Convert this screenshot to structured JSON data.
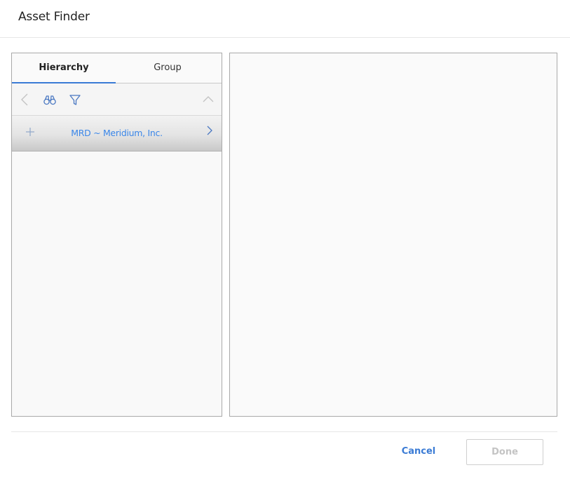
{
  "dialog": {
    "title": "Asset Finder"
  },
  "tabs": [
    {
      "label": "Hierarchy",
      "active": true
    },
    {
      "label": "Group",
      "active": false
    }
  ],
  "toolbar": {
    "icons": [
      "back-chevron-icon",
      "binoculars-icon",
      "filter-icon",
      "collapse-chevron-up-icon"
    ]
  },
  "tree": {
    "items": [
      {
        "label": "MRD ~ Meridium, Inc.",
        "expand_icon": "plus-icon",
        "nav_icon": "chevron-right-icon"
      }
    ]
  },
  "footer": {
    "cancel_label": "Cancel",
    "done_label": "Done",
    "done_enabled": false
  },
  "colors": {
    "accent": "#3a7bd5",
    "link": "#3a86e8",
    "disabled": "#c4c4c4"
  }
}
